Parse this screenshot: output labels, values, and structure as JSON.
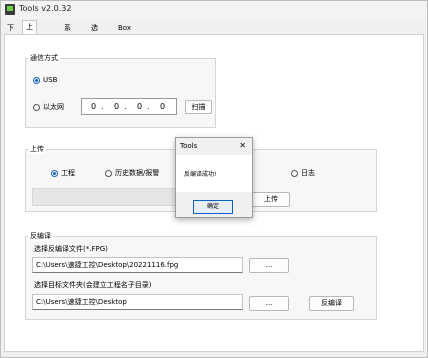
{
  "window": {
    "title": "Tools v2.0.32"
  },
  "tabs": [
    {
      "label": "下载"
    },
    {
      "label": "上传"
    },
    {
      "label": "系统"
    },
    {
      "label": "选件"
    },
    {
      "label": "Box参数"
    }
  ],
  "comm": {
    "title": "通信方式",
    "usb_label": "USB",
    "usb_selected": true,
    "ethernet_label": "以太网",
    "ethernet_selected": false,
    "ip": [
      "0",
      "0",
      "0",
      "0"
    ],
    "scan_label": "扫描"
  },
  "upload": {
    "title": "上传",
    "options": [
      {
        "label": "工程",
        "selected": true
      },
      {
        "label": "历史数据/报警",
        "selected": false
      },
      {
        "label": "日志",
        "selected": false
      }
    ],
    "upload_button": "上传"
  },
  "decompile": {
    "title": "反编译",
    "source_label": "选择反编译文件(*.FPG)",
    "source_value": "C:\\Users\\速捷工控\\Desktop\\20221116.fpg",
    "browse1_label": "...",
    "target_label": "选择目标文件夹(会建立工程名子目录)",
    "target_value": "C:\\Users\\速捷工控\\Desktop",
    "browse2_label": "...",
    "decompile_button": "反编译"
  },
  "dialog": {
    "title": "Tools",
    "close_glyph": "✕",
    "message": "反编译成功!",
    "ok_label": "确定"
  }
}
